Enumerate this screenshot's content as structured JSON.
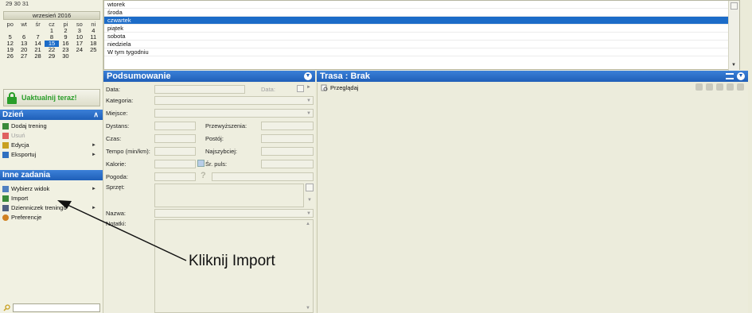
{
  "calendar": {
    "prev_row": [
      "29",
      "30",
      "31"
    ],
    "month_title": "wrzesień 2016",
    "weekdays": [
      "po",
      "wt",
      "śr",
      "cz",
      "pi",
      "so",
      "ni"
    ],
    "weeks": [
      [
        "",
        "",
        "",
        "1",
        "2",
        "3",
        "4"
      ],
      [
        "5",
        "6",
        "7",
        "8",
        "9",
        "10",
        "11"
      ],
      [
        "12",
        "13",
        "14",
        "15",
        "16",
        "17",
        "18"
      ],
      [
        "19",
        "20",
        "21",
        "22",
        "23",
        "24",
        "25"
      ],
      [
        "26",
        "27",
        "28",
        "29",
        "30",
        "",
        ""
      ]
    ],
    "selected_day": "15"
  },
  "days_list": {
    "items": [
      "wtorek",
      "środa",
      "czwartek",
      "piątek",
      "sobota",
      "niedziela",
      "W tym tygodniu"
    ],
    "selected": "czwartek"
  },
  "update_button": {
    "label": "Uaktualnij teraz!"
  },
  "day_section": {
    "title": "Dzień",
    "items": [
      {
        "label": "Dodaj trening",
        "icon": "add-icon",
        "disabled": false,
        "submenu": false
      },
      {
        "label": "Usuń",
        "icon": "delete-icon",
        "disabled": true,
        "submenu": false
      },
      {
        "label": "Edycja",
        "icon": "pencil-icon",
        "disabled": false,
        "submenu": true
      },
      {
        "label": "Eksportuj",
        "icon": "export-icon",
        "disabled": false,
        "submenu": true
      }
    ]
  },
  "tasks_section": {
    "title": "Inne zadania",
    "items": [
      {
        "label": "Wybierz widok",
        "icon": "view-icon",
        "submenu": true
      },
      {
        "label": "Import",
        "icon": "import-icon",
        "submenu": false
      },
      {
        "label": "Dzienniczek treningu",
        "icon": "journal-icon",
        "submenu": true
      },
      {
        "label": "Preferencje",
        "icon": "preferences-icon",
        "submenu": false
      }
    ]
  },
  "summary": {
    "title": "Podsumowanie",
    "labels": {
      "data": "Data:",
      "data_right": "Data:",
      "kategoria": "Kategoria:",
      "miejsce": "Miejsce:",
      "dystans": "Dystans:",
      "przewyzszenia": "Przewyższenia:",
      "czas": "Czas:",
      "postoj": "Postój:",
      "tempo": "Tempo (min/km):",
      "najszybciej": "Najszybciej:",
      "kalorie": "Kalorie:",
      "sr_puls": "Śr. puls:",
      "pogoda": "Pogoda:",
      "sprzet": "Sprzęt:",
      "nazwa": "Nazwa:",
      "notatki": "Notatki:"
    },
    "weather_placeholder": "?"
  },
  "route": {
    "title": "Trasa : Brak",
    "browse_label": "Przeglądaj"
  },
  "annotation": {
    "text": "Kliknij Import"
  },
  "colors": {
    "accent": "#1f5fb8",
    "selection": "#1c6cc8",
    "update_green": "#2a9e2a"
  }
}
